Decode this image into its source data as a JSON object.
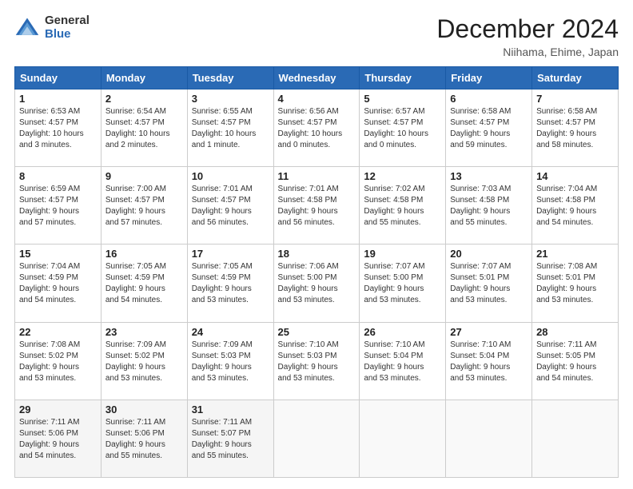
{
  "header": {
    "logo_general": "General",
    "logo_blue": "Blue",
    "month_title": "December 2024",
    "location": "Niihama, Ehime, Japan"
  },
  "weekdays": [
    "Sunday",
    "Monday",
    "Tuesday",
    "Wednesday",
    "Thursday",
    "Friday",
    "Saturday"
  ],
  "weeks": [
    [
      {
        "day": "1",
        "info": "Sunrise: 6:53 AM\nSunset: 4:57 PM\nDaylight: 10 hours\nand 3 minutes."
      },
      {
        "day": "2",
        "info": "Sunrise: 6:54 AM\nSunset: 4:57 PM\nDaylight: 10 hours\nand 2 minutes."
      },
      {
        "day": "3",
        "info": "Sunrise: 6:55 AM\nSunset: 4:57 PM\nDaylight: 10 hours\nand 1 minute."
      },
      {
        "day": "4",
        "info": "Sunrise: 6:56 AM\nSunset: 4:57 PM\nDaylight: 10 hours\nand 0 minutes."
      },
      {
        "day": "5",
        "info": "Sunrise: 6:57 AM\nSunset: 4:57 PM\nDaylight: 10 hours\nand 0 minutes."
      },
      {
        "day": "6",
        "info": "Sunrise: 6:58 AM\nSunset: 4:57 PM\nDaylight: 9 hours\nand 59 minutes."
      },
      {
        "day": "7",
        "info": "Sunrise: 6:58 AM\nSunset: 4:57 PM\nDaylight: 9 hours\nand 58 minutes."
      }
    ],
    [
      {
        "day": "8",
        "info": "Sunrise: 6:59 AM\nSunset: 4:57 PM\nDaylight: 9 hours\nand 57 minutes."
      },
      {
        "day": "9",
        "info": "Sunrise: 7:00 AM\nSunset: 4:57 PM\nDaylight: 9 hours\nand 57 minutes."
      },
      {
        "day": "10",
        "info": "Sunrise: 7:01 AM\nSunset: 4:57 PM\nDaylight: 9 hours\nand 56 minutes."
      },
      {
        "day": "11",
        "info": "Sunrise: 7:01 AM\nSunset: 4:58 PM\nDaylight: 9 hours\nand 56 minutes."
      },
      {
        "day": "12",
        "info": "Sunrise: 7:02 AM\nSunset: 4:58 PM\nDaylight: 9 hours\nand 55 minutes."
      },
      {
        "day": "13",
        "info": "Sunrise: 7:03 AM\nSunset: 4:58 PM\nDaylight: 9 hours\nand 55 minutes."
      },
      {
        "day": "14",
        "info": "Sunrise: 7:04 AM\nSunset: 4:58 PM\nDaylight: 9 hours\nand 54 minutes."
      }
    ],
    [
      {
        "day": "15",
        "info": "Sunrise: 7:04 AM\nSunset: 4:59 PM\nDaylight: 9 hours\nand 54 minutes."
      },
      {
        "day": "16",
        "info": "Sunrise: 7:05 AM\nSunset: 4:59 PM\nDaylight: 9 hours\nand 54 minutes."
      },
      {
        "day": "17",
        "info": "Sunrise: 7:05 AM\nSunset: 4:59 PM\nDaylight: 9 hours\nand 53 minutes."
      },
      {
        "day": "18",
        "info": "Sunrise: 7:06 AM\nSunset: 5:00 PM\nDaylight: 9 hours\nand 53 minutes."
      },
      {
        "day": "19",
        "info": "Sunrise: 7:07 AM\nSunset: 5:00 PM\nDaylight: 9 hours\nand 53 minutes."
      },
      {
        "day": "20",
        "info": "Sunrise: 7:07 AM\nSunset: 5:01 PM\nDaylight: 9 hours\nand 53 minutes."
      },
      {
        "day": "21",
        "info": "Sunrise: 7:08 AM\nSunset: 5:01 PM\nDaylight: 9 hours\nand 53 minutes."
      }
    ],
    [
      {
        "day": "22",
        "info": "Sunrise: 7:08 AM\nSunset: 5:02 PM\nDaylight: 9 hours\nand 53 minutes."
      },
      {
        "day": "23",
        "info": "Sunrise: 7:09 AM\nSunset: 5:02 PM\nDaylight: 9 hours\nand 53 minutes."
      },
      {
        "day": "24",
        "info": "Sunrise: 7:09 AM\nSunset: 5:03 PM\nDaylight: 9 hours\nand 53 minutes."
      },
      {
        "day": "25",
        "info": "Sunrise: 7:10 AM\nSunset: 5:03 PM\nDaylight: 9 hours\nand 53 minutes."
      },
      {
        "day": "26",
        "info": "Sunrise: 7:10 AM\nSunset: 5:04 PM\nDaylight: 9 hours\nand 53 minutes."
      },
      {
        "day": "27",
        "info": "Sunrise: 7:10 AM\nSunset: 5:04 PM\nDaylight: 9 hours\nand 53 minutes."
      },
      {
        "day": "28",
        "info": "Sunrise: 7:11 AM\nSunset: 5:05 PM\nDaylight: 9 hours\nand 54 minutes."
      }
    ],
    [
      {
        "day": "29",
        "info": "Sunrise: 7:11 AM\nSunset: 5:06 PM\nDaylight: 9 hours\nand 54 minutes."
      },
      {
        "day": "30",
        "info": "Sunrise: 7:11 AM\nSunset: 5:06 PM\nDaylight: 9 hours\nand 55 minutes."
      },
      {
        "day": "31",
        "info": "Sunrise: 7:11 AM\nSunset: 5:07 PM\nDaylight: 9 hours\nand 55 minutes."
      },
      {
        "day": "",
        "info": ""
      },
      {
        "day": "",
        "info": ""
      },
      {
        "day": "",
        "info": ""
      },
      {
        "day": "",
        "info": ""
      }
    ]
  ]
}
